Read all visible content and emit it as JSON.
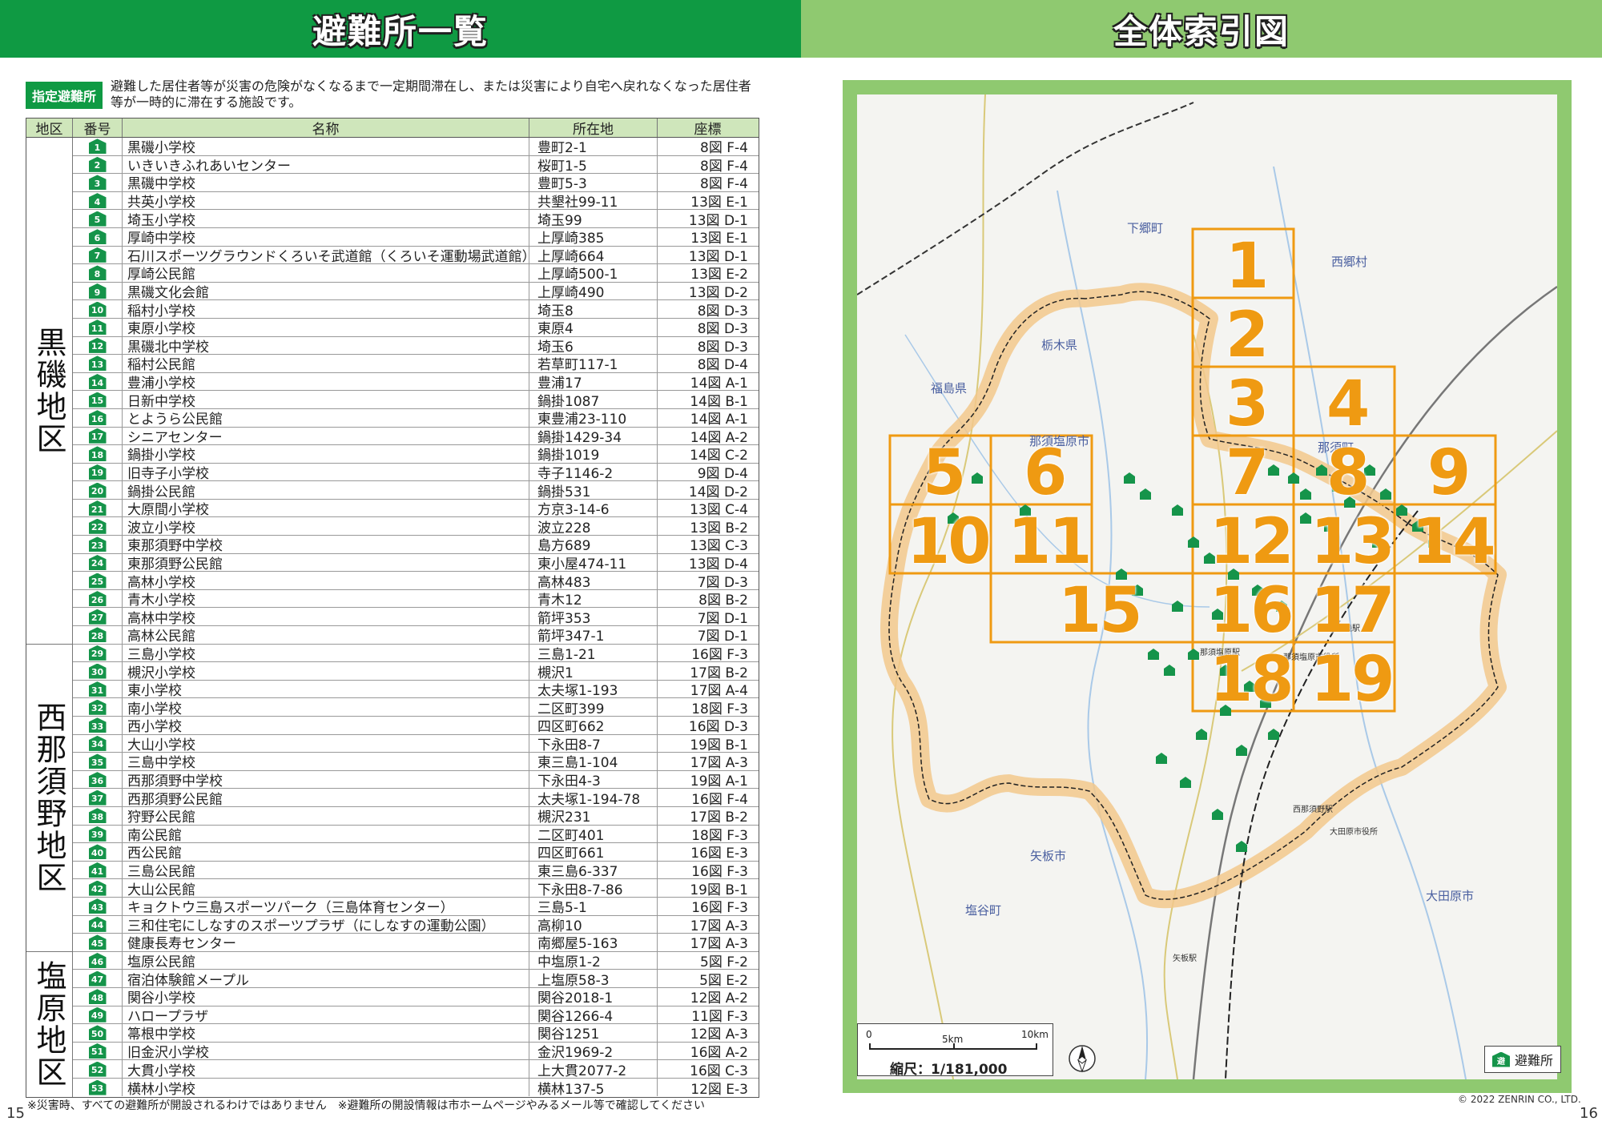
{
  "left_title": "避難所一覧",
  "right_title": "全体索引図",
  "intro": {
    "badge": "指定避難所",
    "text": "避難した居住者等が災害の危険がなくなるまで一定期間滞在し、または災害により自宅へ戻れなくなった居住者等が一時的に滞在する施設です。"
  },
  "table": {
    "headers": {
      "district": "地区",
      "number": "番号",
      "name": "名称",
      "address": "所在地",
      "map": "座標"
    },
    "districts": [
      {
        "name": "黒磯地区",
        "rows": [
          {
            "n": "1",
            "name": "黒磯小学校",
            "addr": "豊町2-1",
            "map": "8図 F-4"
          },
          {
            "n": "2",
            "name": "いきいきふれあいセンター",
            "addr": "桜町1-5",
            "map": "8図 F-4"
          },
          {
            "n": "3",
            "name": "黒磯中学校",
            "addr": "豊町5-3",
            "map": "8図 F-4"
          },
          {
            "n": "4",
            "name": "共英小学校",
            "addr": "共墾社99-11",
            "map": "13図 E-1"
          },
          {
            "n": "5",
            "name": "埼玉小学校",
            "addr": "埼玉99",
            "map": "13図 D-1"
          },
          {
            "n": "6",
            "name": "厚崎中学校",
            "addr": "上厚崎385",
            "map": "13図 E-1"
          },
          {
            "n": "7",
            "name": "石川スポーツグラウンドくろいそ武道館（くろいそ運動場武道館）",
            "addr": "上厚崎664",
            "map": "13図 D-1"
          },
          {
            "n": "8",
            "name": "厚崎公民館",
            "addr": "上厚崎500-1",
            "map": "13図 E-2"
          },
          {
            "n": "9",
            "name": "黒磯文化会館",
            "addr": "上厚崎490",
            "map": "13図 D-2"
          },
          {
            "n": "10",
            "name": "稲村小学校",
            "addr": "埼玉8",
            "map": "8図 D-3"
          },
          {
            "n": "11",
            "name": "東原小学校",
            "addr": "東原4",
            "map": "8図 D-3"
          },
          {
            "n": "12",
            "name": "黒磯北中学校",
            "addr": "埼玉6",
            "map": "8図 D-3"
          },
          {
            "n": "13",
            "name": "稲村公民館",
            "addr": "若草町117-1",
            "map": "8図 D-4"
          },
          {
            "n": "14",
            "name": "豊浦小学校",
            "addr": "豊浦17",
            "map": "14図 A-1"
          },
          {
            "n": "15",
            "name": "日新中学校",
            "addr": "鍋掛1087",
            "map": "14図 B-1"
          },
          {
            "n": "16",
            "name": "とようら公民館",
            "addr": "東豊浦23-110",
            "map": "14図 A-1"
          },
          {
            "n": "17",
            "name": "シニアセンター",
            "addr": "鍋掛1429-34",
            "map": "14図 A-2"
          },
          {
            "n": "18",
            "name": "鍋掛小学校",
            "addr": "鍋掛1019",
            "map": "14図 C-2"
          },
          {
            "n": "19",
            "name": "旧寺子小学校",
            "addr": "寺子1146-2",
            "map": "9図 D-4"
          },
          {
            "n": "20",
            "name": "鍋掛公民館",
            "addr": "鍋掛531",
            "map": "14図 D-2"
          },
          {
            "n": "21",
            "name": "大原間小学校",
            "addr": "方京3-14-6",
            "map": "13図 C-4"
          },
          {
            "n": "22",
            "name": "波立小学校",
            "addr": "波立228",
            "map": "13図 B-2"
          },
          {
            "n": "23",
            "name": "東那須野中学校",
            "addr": "島方689",
            "map": "13図 C-3"
          },
          {
            "n": "24",
            "name": "東那須野公民館",
            "addr": "東小屋474-11",
            "map": "13図 D-4"
          },
          {
            "n": "25",
            "name": "高林小学校",
            "addr": "高林483",
            "map": "7図 D-3"
          },
          {
            "n": "26",
            "name": "青木小学校",
            "addr": "青木12",
            "map": "8図 B-2"
          },
          {
            "n": "27",
            "name": "高林中学校",
            "addr": "箭坪353",
            "map": "7図 D-1"
          },
          {
            "n": "28",
            "name": "高林公民館",
            "addr": "箭坪347-1",
            "map": "7図 D-1"
          }
        ]
      },
      {
        "name": "西那須野地区",
        "rows": [
          {
            "n": "29",
            "name": "三島小学校",
            "addr": "三島1-21",
            "map": "16図 F-3"
          },
          {
            "n": "30",
            "name": "槻沢小学校",
            "addr": "槻沢1",
            "map": "17図 B-2"
          },
          {
            "n": "31",
            "name": "東小学校",
            "addr": "太夫塚1-193",
            "map": "17図 A-4"
          },
          {
            "n": "32",
            "name": "南小学校",
            "addr": "二区町399",
            "map": "18図 F-3"
          },
          {
            "n": "33",
            "name": "西小学校",
            "addr": "四区町662",
            "map": "16図 D-3"
          },
          {
            "n": "34",
            "name": "大山小学校",
            "addr": "下永田8-7",
            "map": "19図 B-1"
          },
          {
            "n": "35",
            "name": "三島中学校",
            "addr": "東三島1-104",
            "map": "17図 A-3"
          },
          {
            "n": "36",
            "name": "西那須野中学校",
            "addr": "下永田4-3",
            "map": "19図 A-1"
          },
          {
            "n": "37",
            "name": "西那須野公民館",
            "addr": "太夫塚1-194-78",
            "map": "16図 F-4"
          },
          {
            "n": "38",
            "name": "狩野公民館",
            "addr": "槻沢231",
            "map": "17図 B-2"
          },
          {
            "n": "39",
            "name": "南公民館",
            "addr": "二区町401",
            "map": "18図 F-3"
          },
          {
            "n": "40",
            "name": "西公民館",
            "addr": "四区町661",
            "map": "16図 E-3"
          },
          {
            "n": "41",
            "name": "三島公民館",
            "addr": "東三島6-337",
            "map": "16図 F-3"
          },
          {
            "n": "42",
            "name": "大山公民館",
            "addr": "下永田8-7-86",
            "map": "19図 B-1"
          },
          {
            "n": "43",
            "name": "キョクトウ三島スポーツパーク（三島体育センター）",
            "addr": "三島5-1",
            "map": "16図 F-3"
          },
          {
            "n": "44",
            "name": "三和住宅にしなすのスポーツプラザ（にしなすの運動公園）",
            "addr": "高柳10",
            "map": "17図 A-3"
          },
          {
            "n": "45",
            "name": "健康長寿センター",
            "addr": "南郷屋5-163",
            "map": "17図 A-3"
          }
        ]
      },
      {
        "name": "塩原地区",
        "rows": [
          {
            "n": "46",
            "name": "塩原公民館",
            "addr": "中塩原1-2",
            "map": "5図 F-2"
          },
          {
            "n": "47",
            "name": "宿泊体験館メープル",
            "addr": "上塩原58-3",
            "map": "5図 E-2"
          },
          {
            "n": "48",
            "name": "関谷小学校",
            "addr": "関谷2018-1",
            "map": "12図 A-2"
          },
          {
            "n": "49",
            "name": "ハロープラザ",
            "addr": "関谷1266-4",
            "map": "11図 F-3"
          },
          {
            "n": "50",
            "name": "箒根中学校",
            "addr": "関谷1251",
            "map": "12図 A-3"
          },
          {
            "n": "51",
            "name": "旧金沢小学校",
            "addr": "金沢1969-2",
            "map": "16図 A-2"
          },
          {
            "n": "52",
            "name": "大貫小学校",
            "addr": "上大貫2077-2",
            "map": "16図 C-3"
          },
          {
            "n": "53",
            "name": "横林小学校",
            "addr": "横林137-5",
            "map": "12図 E-3"
          }
        ]
      }
    ]
  },
  "footnote": "※災害時、すべての避難所が開設されるわけではありません　※避難所の開設情報は市ホームページやみるメール等で確認してください",
  "page_left": "15",
  "page_right": "16",
  "map": {
    "cells": [
      "1",
      "2",
      "3",
      "4",
      "5",
      "6",
      "7",
      "8",
      "9",
      "10",
      "11",
      "12",
      "13",
      "14",
      "15",
      "16",
      "17",
      "18",
      "19"
    ],
    "labels": {
      "tochigi": "栃木県",
      "fukushima": "福島県",
      "nasushiobara": "那須塩原市",
      "nasu": "那須町",
      "yaita": "矢板市",
      "shioya": "塩谷町",
      "otawara": "大田原市",
      "shimogo": "下郷町",
      "nishigo": "西郷村",
      "kurobane_st": "黒磯駅",
      "nasushiobara_st": "那須塩原駅",
      "nishinasuno_st": "西那須野駅",
      "city_hall": "那須塩原市役所",
      "yaita_st": "矢板駅",
      "otawara_hall": "大田原市役所"
    },
    "scale": {
      "zero": "0",
      "five": "5km",
      "ten": "10km",
      "label": "縮尺：1/181,000"
    },
    "legend_badge": "避",
    "legend_label": "避難所",
    "copyright": "© 2022 ZENRIN CO., LTD.",
    "colors": {
      "accent": "#ef9a12",
      "green_header": "#0f9a43",
      "light_green": "#8fc970",
      "badge": "#15944a"
    }
  }
}
